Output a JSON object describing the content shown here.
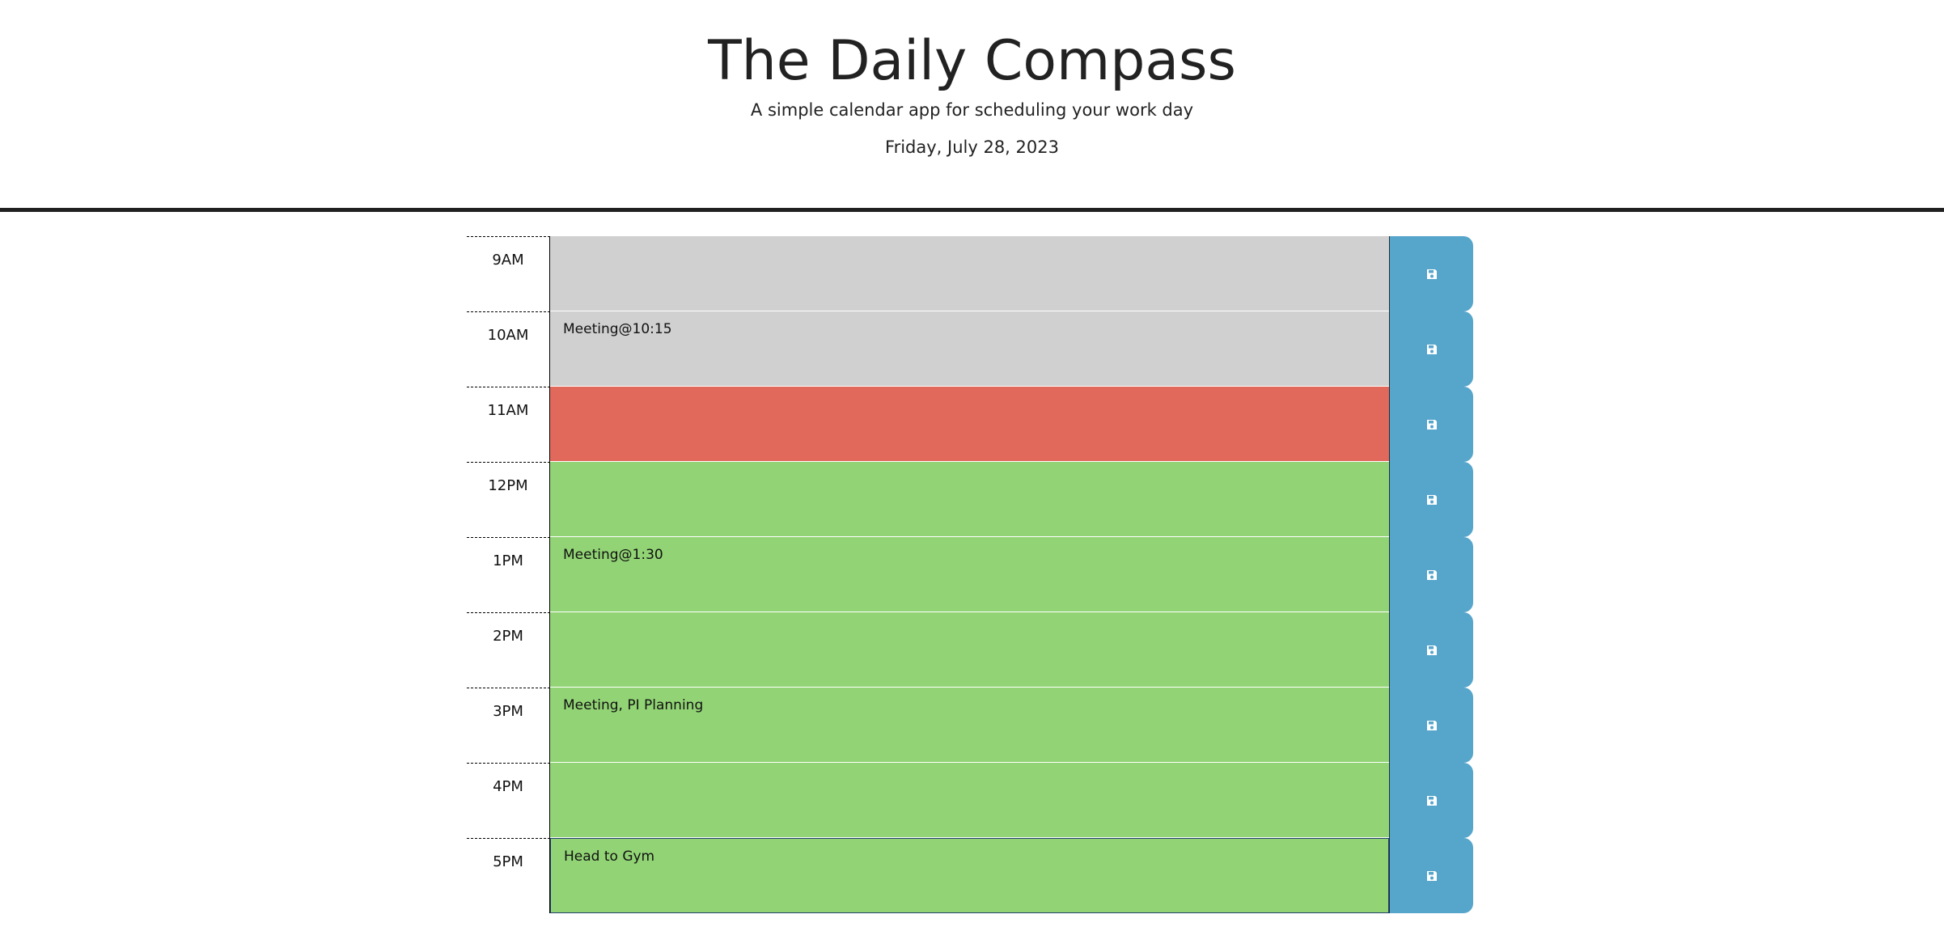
{
  "header": {
    "title": "The Daily Compass",
    "subtitle": "A simple calendar app for scheduling your work day",
    "current_day": "Friday, July 28, 2023"
  },
  "colors": {
    "past": "#d0d0d0",
    "present": "#e0695b",
    "future": "#92d475",
    "save_button": "#56a5cb"
  },
  "time_blocks": [
    {
      "hour": "9AM",
      "status": "past",
      "text": ""
    },
    {
      "hour": "10AM",
      "status": "past",
      "text": "Meeting@10:15"
    },
    {
      "hour": "11AM",
      "status": "present",
      "text": ""
    },
    {
      "hour": "12PM",
      "status": "future",
      "text": ""
    },
    {
      "hour": "1PM",
      "status": "future",
      "text": "Meeting@1:30"
    },
    {
      "hour": "2PM",
      "status": "future",
      "text": ""
    },
    {
      "hour": "3PM",
      "status": "future",
      "text": "Meeting, PI Planning"
    },
    {
      "hour": "4PM",
      "status": "future",
      "text": ""
    },
    {
      "hour": "5PM",
      "status": "future",
      "text": "Head to Gym"
    }
  ],
  "save_icon": "floppy-disk-icon"
}
